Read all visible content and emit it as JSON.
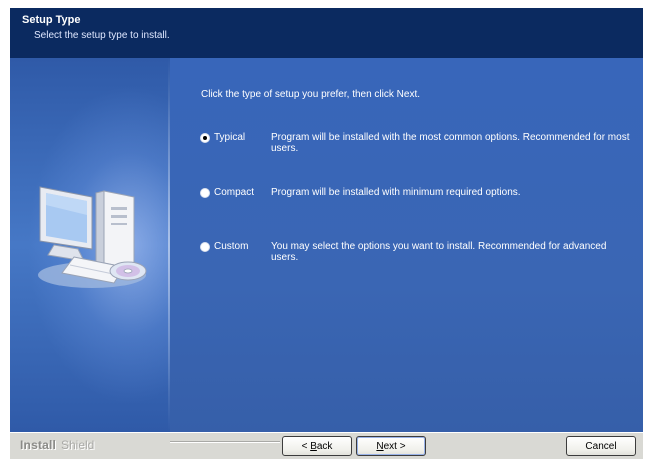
{
  "header": {
    "title": "Setup Type",
    "subtitle": "Select the setup type to install."
  },
  "main": {
    "prompt": "Click the type of setup you prefer, then click Next.",
    "options": [
      {
        "label": "Typical",
        "description": "Program will be installed with the most common options.  Recommended for most users.",
        "selected": true
      },
      {
        "label": "Compact",
        "description": "Program will be installed with minimum required options.",
        "selected": false
      },
      {
        "label": "Custom",
        "description": "You may select the options you want to install. Recommended for advanced users.",
        "selected": false
      }
    ]
  },
  "footer": {
    "brand_bold": "Install",
    "brand_light": "Shield",
    "back_prefix": "< ",
    "back_key": "B",
    "back_rest": "ack",
    "next_key": "N",
    "next_rest": "ext >",
    "cancel_label": "Cancel"
  },
  "colors": {
    "header_bg": "#0b2a60",
    "body_bg": "#3a65b0",
    "footer_bg": "#d9d9d4"
  },
  "icons": {
    "illustration": "computer-with-cd-icon"
  }
}
